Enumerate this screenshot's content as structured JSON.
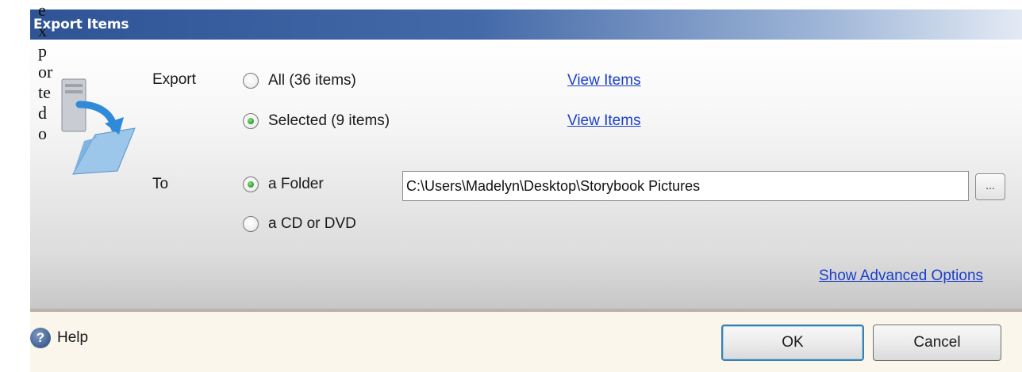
{
  "window": {
    "title": "Export Items"
  },
  "icon_alt_text": "exported o",
  "export": {
    "label": "Export",
    "options": [
      {
        "label": "All  (36 items)",
        "checked": false,
        "link": "View Items"
      },
      {
        "label": "Selected  (9 items)",
        "checked": true,
        "link": "View Items"
      }
    ]
  },
  "destination": {
    "label": "To",
    "options": [
      {
        "label": "a Folder",
        "checked": true
      },
      {
        "label": "a CD or DVD",
        "checked": false
      }
    ],
    "path_value": "C:\\Users\\Madelyn\\Desktop\\Storybook Pictures",
    "browse_label": "..."
  },
  "advanced_link": "Show Advanced Options",
  "footer": {
    "help_label": "Help",
    "help_icon": "?",
    "ok_label": "OK",
    "cancel_label": "Cancel"
  },
  "colors": {
    "titlebar": "#2f5496",
    "link": "#1a3fcc",
    "radio_checked": "#2f9c2a",
    "footer_bg": "#fbf6ec"
  }
}
